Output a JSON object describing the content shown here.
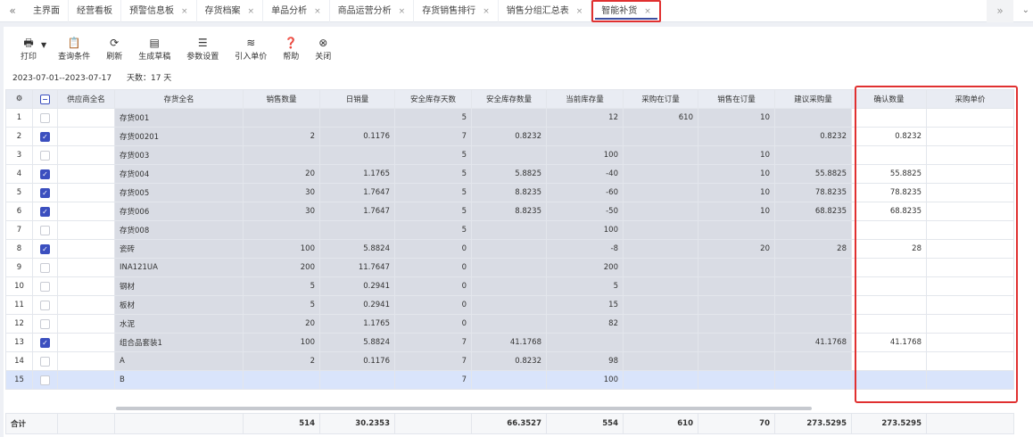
{
  "tabs": [
    {
      "label": "主界面",
      "closable": false
    },
    {
      "label": "经营看板",
      "closable": false
    },
    {
      "label": "预警信息板",
      "closable": true
    },
    {
      "label": "存货档案",
      "closable": true
    },
    {
      "label": "单品分析",
      "closable": true
    },
    {
      "label": "商品运营分析",
      "closable": true
    },
    {
      "label": "存货销售排行",
      "closable": true
    },
    {
      "label": "销售分组汇总表",
      "closable": true
    },
    {
      "label": "智能补货",
      "closable": true,
      "active": true
    }
  ],
  "toolbar": [
    {
      "icon": "printer-icon",
      "glyph": "🖶",
      "label": "打印"
    },
    {
      "icon": "query-icon",
      "glyph": "📋",
      "label": "查询条件"
    },
    {
      "icon": "refresh-icon",
      "glyph": "⟳",
      "label": "刷新"
    },
    {
      "icon": "draft-icon",
      "glyph": "▤",
      "label": "生成草稿"
    },
    {
      "icon": "settings-sliders-icon",
      "glyph": "☰",
      "label": "参数设置"
    },
    {
      "icon": "database-icon",
      "glyph": "≋",
      "label": "引入单价"
    },
    {
      "icon": "help-icon",
      "glyph": "❓",
      "label": "帮助"
    },
    {
      "icon": "close-circle-icon",
      "glyph": "⊗",
      "label": "关闭"
    }
  ],
  "date_range": "2023-07-01--2023-07-17",
  "days": "天数：17 天",
  "columns": [
    "供应商全名",
    "存货全名",
    "销售数量",
    "日销量",
    "安全库存天数",
    "安全库存数量",
    "当前库存量",
    "采购在订量",
    "销售在订量",
    "建议采购量",
    "确认数量",
    "采购单价"
  ],
  "rows": [
    {
      "n": "1",
      "chk": false,
      "v": [
        "",
        "存货001",
        "",
        "",
        "5",
        "",
        "12",
        "610",
        "10",
        "",
        "",
        ""
      ]
    },
    {
      "n": "2",
      "chk": true,
      "v": [
        "",
        "存货00201",
        "2",
        "0.1176",
        "7",
        "0.8232",
        "",
        "",
        "",
        "0.8232",
        "0.8232",
        ""
      ]
    },
    {
      "n": "3",
      "chk": false,
      "v": [
        "",
        "存货003",
        "",
        "",
        "5",
        "",
        "100",
        "",
        "10",
        "",
        "",
        ""
      ]
    },
    {
      "n": "4",
      "chk": true,
      "v": [
        "",
        "存货004",
        "20",
        "1.1765",
        "5",
        "5.8825",
        "-40",
        "",
        "10",
        "55.8825",
        "55.8825",
        ""
      ]
    },
    {
      "n": "5",
      "chk": true,
      "v": [
        "",
        "存货005",
        "30",
        "1.7647",
        "5",
        "8.8235",
        "-60",
        "",
        "10",
        "78.8235",
        "78.8235",
        ""
      ]
    },
    {
      "n": "6",
      "chk": true,
      "v": [
        "",
        "存货006",
        "30",
        "1.7647",
        "5",
        "8.8235",
        "-50",
        "",
        "10",
        "68.8235",
        "68.8235",
        ""
      ]
    },
    {
      "n": "7",
      "chk": false,
      "v": [
        "",
        "存货008",
        "",
        "",
        "5",
        "",
        "100",
        "",
        "",
        "",
        "",
        ""
      ]
    },
    {
      "n": "8",
      "chk": true,
      "v": [
        "",
        "瓷砖",
        "100",
        "5.8824",
        "0",
        "",
        "-8",
        "",
        "20",
        "28",
        "28",
        ""
      ]
    },
    {
      "n": "9",
      "chk": false,
      "v": [
        "",
        "INA121UA",
        "200",
        "11.7647",
        "0",
        "",
        "200",
        "",
        "",
        "",
        "",
        ""
      ]
    },
    {
      "n": "10",
      "chk": false,
      "v": [
        "",
        "钢材",
        "5",
        "0.2941",
        "0",
        "",
        "5",
        "",
        "",
        "",
        "",
        ""
      ]
    },
    {
      "n": "11",
      "chk": false,
      "v": [
        "",
        "板材",
        "5",
        "0.2941",
        "0",
        "",
        "15",
        "",
        "",
        "",
        "",
        ""
      ]
    },
    {
      "n": "12",
      "chk": false,
      "v": [
        "",
        "水泥",
        "20",
        "1.1765",
        "0",
        "",
        "82",
        "",
        "",
        "",
        "",
        ""
      ]
    },
    {
      "n": "13",
      "chk": true,
      "v": [
        "",
        "组合品套装1",
        "100",
        "5.8824",
        "7",
        "41.1768",
        "",
        "",
        "",
        "41.1768",
        "41.1768",
        ""
      ]
    },
    {
      "n": "14",
      "chk": false,
      "v": [
        "",
        "A",
        "2",
        "0.1176",
        "7",
        "0.8232",
        "98",
        "",
        "",
        "",
        "",
        ""
      ]
    },
    {
      "n": "15",
      "chk": false,
      "selected": true,
      "v": [
        "",
        "B",
        "",
        "",
        "7",
        "",
        "100",
        "",
        "",
        "",
        "",
        ""
      ]
    }
  ],
  "totals": {
    "label": "合计",
    "v": [
      "",
      "",
      "514",
      "30.2353",
      "",
      "66.3527",
      "554",
      "610",
      "70",
      "273.5295",
      "273.5295",
      ""
    ]
  }
}
